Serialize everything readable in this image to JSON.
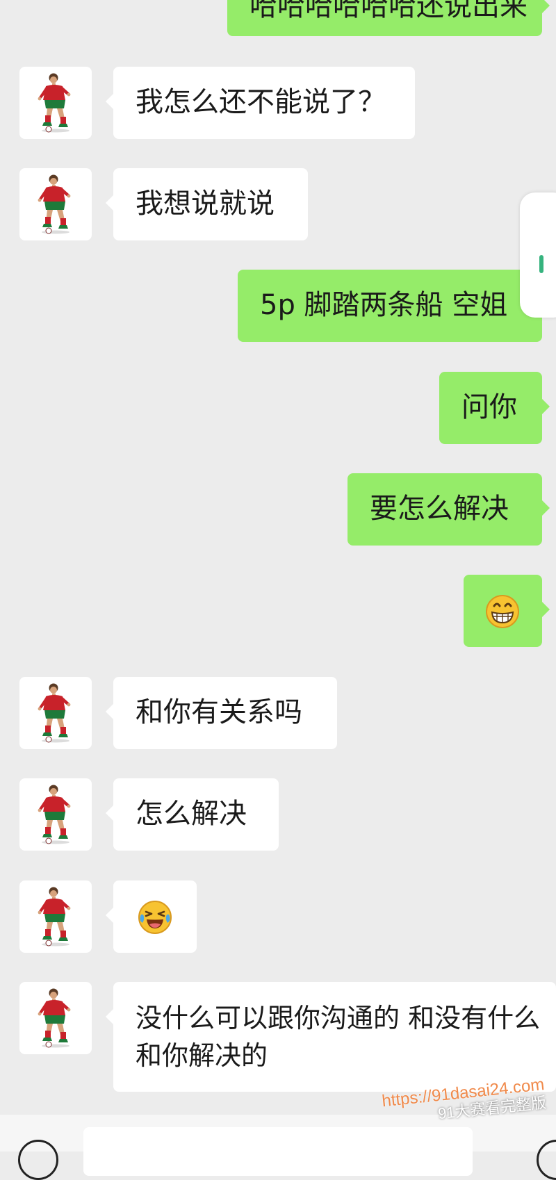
{
  "messages": [
    {
      "side": "out",
      "text": "哈哈哈哈哈哈还说出来"
    },
    {
      "side": "in",
      "text": "我怎么还不能说了？"
    },
    {
      "side": "in",
      "text": "我想说就说"
    },
    {
      "side": "out",
      "text": "5p 脚踏两条船 空姐"
    },
    {
      "side": "out",
      "text": "问你"
    },
    {
      "side": "out",
      "text": "要怎么解决"
    },
    {
      "side": "out",
      "emoji": "grinning-face-emoji"
    },
    {
      "side": "in",
      "text": "和你有关系吗"
    },
    {
      "side": "in",
      "text": "怎么解决"
    },
    {
      "side": "in",
      "emoji": "face-with-tears-of-joy-emoji"
    },
    {
      "side": "in",
      "text": "没什么可以跟你沟通的 和没有什么和你解决的"
    }
  ],
  "contact_avatar_icon": "soccer-player-avatar",
  "colors": {
    "chat_background": "#ececec",
    "incoming_bubble": "#ffffff",
    "outgoing_bubble": "#95ec69"
  },
  "input_bar": {
    "voice_icon": "voice-icon",
    "emoji_icon": "emoji-icon"
  },
  "watermark": {
    "url": "https://91dasai24.com",
    "tagline": "91大赛看完整版"
  }
}
